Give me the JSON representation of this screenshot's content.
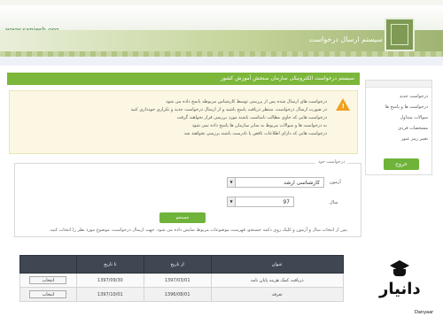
{
  "header": {
    "site_url": "www.sanjesh.org",
    "title": "سیستم ارسال درخواست"
  },
  "main": {
    "bar_title": "سیستم درخواست الکترونیکی سازمان سنجش آموزش کشور"
  },
  "notice": {
    "items": [
      "درخواست های ارسال شده پس از بررسی توسط کارشناس مربوطه پاسخ داده می شود",
      "در صورت ارسال درخواست، منتظر دریافت پاسخ باشید و از ارسال درخواست جدید و تکراری خودداری کنید",
      "درخواست هایی که حاوی مطالب نامناسب باشند مورد بررسی قرار نخواهند گرفت",
      "به درخواست ها و سوالات مربوط به سایر سازمان ها پاسخ داده نمی شود",
      "درخواست هایی که دارای اطلاعات ناقص یا نادرست باشند بررسی نخواهند شد"
    ]
  },
  "sidebar": {
    "items": [
      "درخواست جدید",
      "درخواست ها و پاسخ ها",
      "سوالات متداول",
      "مشخصات فردی",
      "تغییر رمز عبور"
    ],
    "exit_label": "خروج"
  },
  "form": {
    "legend": "درخواست خود",
    "level_label": "آزمون",
    "level_value": "کارشناسی ارشد",
    "year_label": "سال",
    "year_value": "97",
    "search_label": "جستجو",
    "hint": "پس از انتخاب سال و آزمون و کلیک روی دکمه جستجو، فهرست موضوعات مربوط نمایش داده می شود. جهت ارسال درخواست، موضوع مورد نظر را انتخاب کنید."
  },
  "table": {
    "headers": [
      "عنوان",
      "از تاریخ",
      "تا تاریخ",
      ""
    ],
    "rows": [
      {
        "title": "دریافت کمک هزینه پایان نامه",
        "from": "1397/03/01",
        "to": "1397/09/30",
        "action": "انتخاب"
      },
      {
        "title": "تعرفه",
        "from": "1396/08/01",
        "to": "1397/10/01",
        "action": "انتخاب"
      }
    ]
  },
  "watermark": {
    "brand": "دانیار",
    "sub": "Danyaar"
  }
}
